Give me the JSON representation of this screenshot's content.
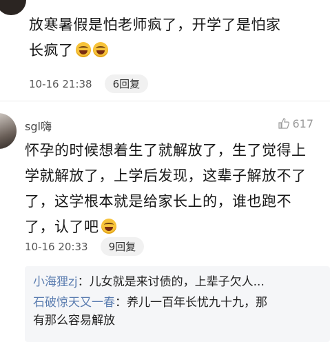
{
  "comment_top": {
    "username": "",
    "like_count": "",
    "text_line1": "放寒暑假是怕老师疯了，开学了是怕家",
    "text_line2": "长疯了",
    "emoji": "grinning-face",
    "timestamp": "10-16 21:38",
    "replies_label": "6回复"
  },
  "comment_second": {
    "username": "sgl嗨",
    "like_count": "617",
    "text_lines": [
      "怀孕的时候想着生了就解放了，生了觉得上",
      "学就解放了，上学后发现，这辈子解放不了",
      "了，这学根本就是给家长上的，谁也跑不",
      "了，认了吧"
    ],
    "emoji": "tears-of-joy",
    "timestamp": "10-16 20:33",
    "replies_label": "9回复",
    "sub_replies": [
      {
        "user": "小海狸zj",
        "text": "：儿女就是来讨债的，上辈子欠人..."
      },
      {
        "user": "石破惊天又一春",
        "text": "：养儿一百年长忧九十九，那"
      },
      {
        "user": "",
        "text": "有那么容易解放"
      }
    ]
  }
}
